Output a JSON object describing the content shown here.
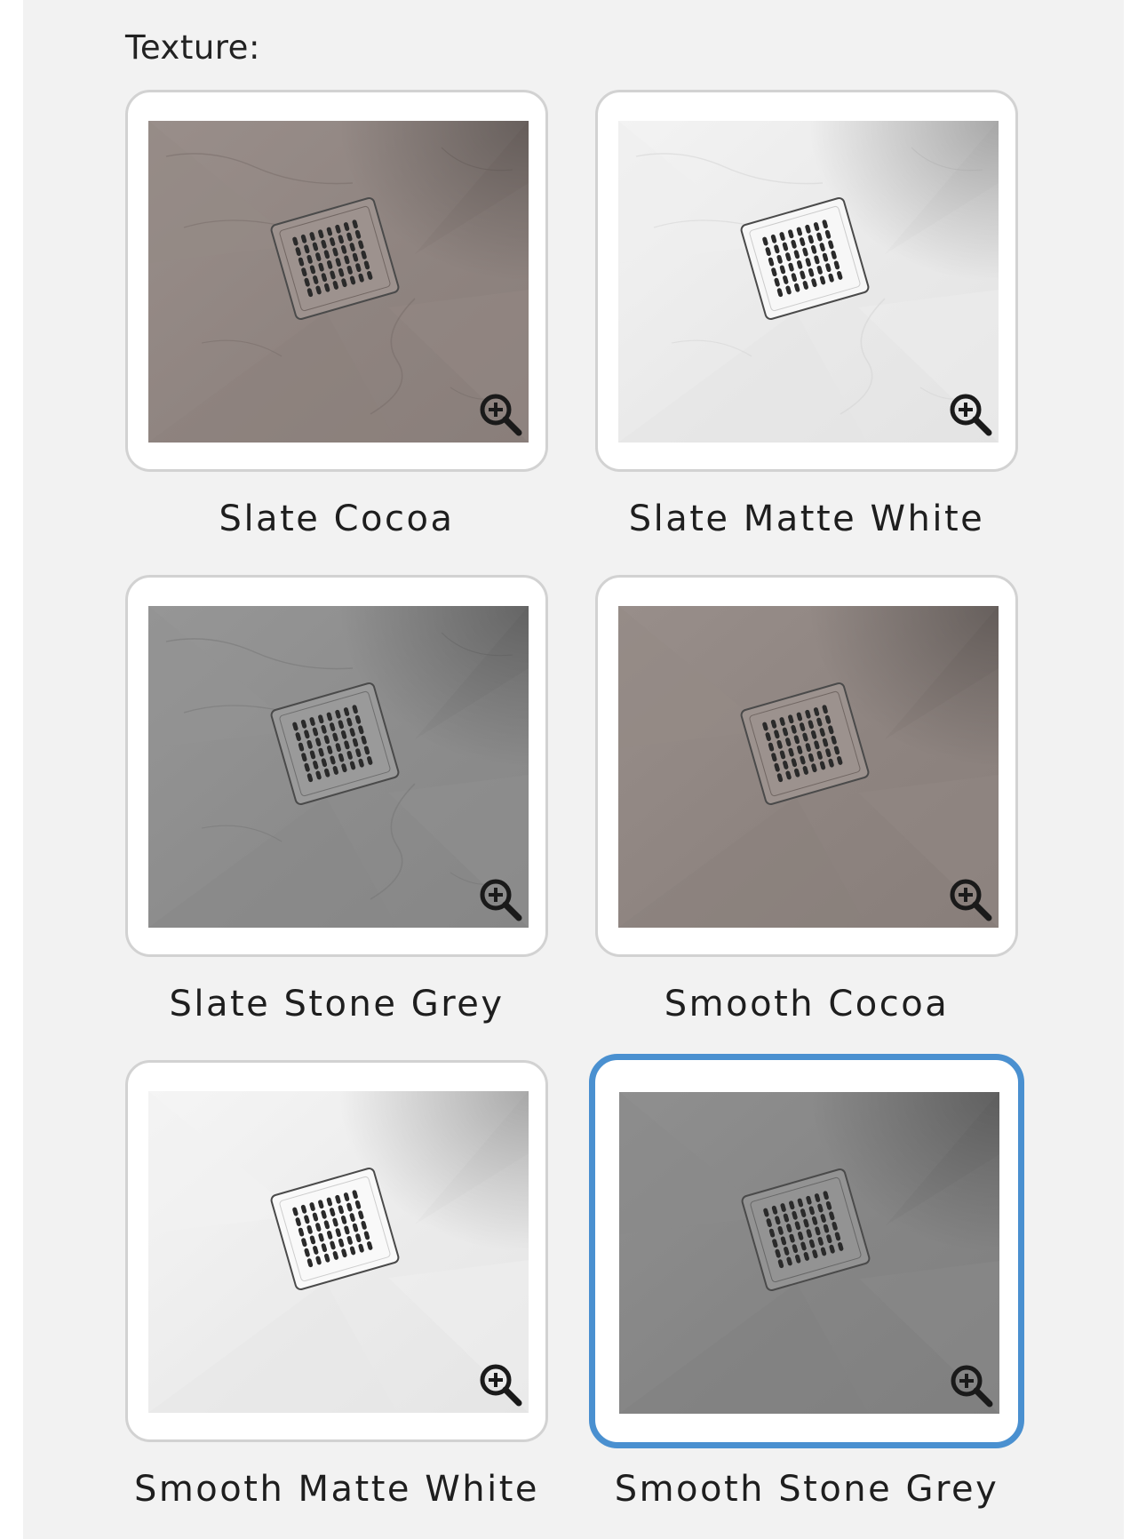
{
  "texture_selector": {
    "label": "Texture:",
    "selected_index": 5,
    "accent_color": "#4a90d0",
    "options": [
      {
        "name": "Slate Cocoa",
        "finish": "slate",
        "color": "#8f8480",
        "zoom_icon": "zoom-in-icon"
      },
      {
        "name": "Slate Matte White",
        "finish": "slate",
        "color": "#e9e9e9",
        "zoom_icon": "zoom-in-icon"
      },
      {
        "name": "Slate Stone Grey",
        "finish": "slate",
        "color": "#8c8c8c",
        "zoom_icon": "zoom-in-icon"
      },
      {
        "name": "Smooth Cocoa",
        "finish": "smooth",
        "color": "#8e8480",
        "zoom_icon": "zoom-in-icon"
      },
      {
        "name": "Smooth Matte White",
        "finish": "smooth",
        "color": "#ebebeb",
        "zoom_icon": "zoom-in-icon"
      },
      {
        "name": "Smooth Stone Grey",
        "finish": "smooth",
        "color": "#858585",
        "zoom_icon": "zoom-in-icon"
      }
    ]
  }
}
